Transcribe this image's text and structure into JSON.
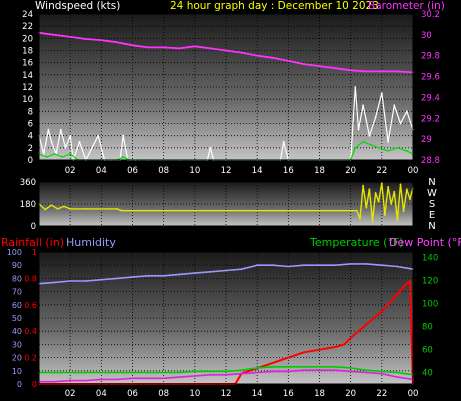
{
  "header": {
    "windspeed_label": "Windspeed (kts)",
    "date_title": "24 hour graph day : December 10 2023",
    "barometer_label": "Barometer (in)"
  },
  "labels": {
    "rainfall": "Rainfall (in)",
    "humidity": "Humidity",
    "temperature": "Temperature (°F)",
    "dewpoint": "Dew Point (°F)"
  },
  "colors": {
    "windspeed": "#ffffff",
    "windgust": "#ffffff",
    "windavg": "#00dd00",
    "barometer": "#ff33ff",
    "direction": "#e6e600",
    "rainfall": "#ff0000",
    "humidity": "#9999ff",
    "temperature": "#00cc00",
    "dewpoint": "#dd22dd",
    "title": "#ffff00",
    "axis": "#ffffff"
  },
  "x_ticks": [
    "02",
    "04",
    "06",
    "08",
    "10",
    "12",
    "14",
    "16",
    "18",
    "20",
    "22",
    "00"
  ],
  "chart_data": [
    {
      "type": "line",
      "name": "wind-barometer",
      "x_range_hours": [
        0,
        24
      ],
      "y_left": {
        "ticks": [
          "0",
          "2",
          "4",
          "6",
          "8",
          "10",
          "12",
          "14",
          "16",
          "18",
          "20",
          "22",
          "24"
        ],
        "ylim": [
          0,
          24
        ]
      },
      "y_right": {
        "ticks": [
          "28.8",
          "29",
          "29.2",
          "29.4",
          "29.6",
          "29.8",
          "30",
          "30.2"
        ],
        "ylim": [
          28.8,
          30.2
        ]
      },
      "series": [
        {
          "key": "barometer",
          "axis": "right",
          "x": [
            0,
            1,
            2,
            3,
            4,
            5,
            6,
            7,
            8,
            9,
            10,
            11,
            12,
            13,
            14,
            15,
            16,
            17,
            18,
            19,
            20,
            21,
            22,
            23,
            24
          ],
          "y": [
            30.02,
            30.0,
            29.98,
            29.96,
            29.95,
            29.93,
            29.9,
            29.88,
            29.88,
            29.87,
            29.89,
            29.87,
            29.85,
            29.83,
            29.8,
            29.78,
            29.75,
            29.72,
            29.7,
            29.68,
            29.66,
            29.65,
            29.65,
            29.65,
            29.64
          ]
        },
        {
          "key": "windgust",
          "axis": "left",
          "x": [
            0,
            0.3,
            0.6,
            0.8,
            1.1,
            1.4,
            1.7,
            2.0,
            2.2,
            2.6,
            3.0,
            3.4,
            3.8,
            4.2,
            4.6,
            5.2,
            5.4,
            5.7,
            6.2,
            7.0,
            9.0,
            10.8,
            11.0,
            11.2,
            12.0,
            14.0,
            15.5,
            15.7,
            16.0,
            18.0,
            20.0,
            20.3,
            20.5,
            20.8,
            21.2,
            21.6,
            22.0,
            22.4,
            22.8,
            23.2,
            23.6,
            24.0
          ],
          "y": [
            4,
            1,
            5,
            3,
            1,
            5,
            2,
            4,
            0,
            3,
            0,
            2,
            4,
            0,
            0,
            0,
            4,
            0,
            0,
            0,
            0,
            0,
            2,
            0,
            0,
            0,
            0,
            3,
            0,
            0,
            0,
            12,
            5,
            9,
            4,
            7,
            11,
            3,
            9,
            6,
            8,
            5
          ]
        },
        {
          "key": "windavg",
          "axis": "left",
          "x": [
            0,
            0.5,
            1.0,
            1.5,
            2.0,
            2.5,
            3.0,
            4.0,
            5.0,
            5.4,
            5.8,
            7.0,
            10.0,
            12.0,
            14.0,
            16.0,
            18.0,
            20.0,
            20.3,
            20.8,
            21.3,
            21.8,
            22.4,
            23.0,
            23.6,
            24.0
          ],
          "y": [
            1,
            0.5,
            1,
            0.5,
            1,
            0,
            0,
            0,
            0,
            0.5,
            0,
            0,
            0,
            0,
            0,
            0,
            0,
            0,
            2,
            3,
            2.5,
            2,
            1.5,
            2,
            1.5,
            1
          ]
        }
      ]
    },
    {
      "type": "line",
      "name": "wind-direction",
      "x_range_hours": [
        0,
        24
      ],
      "y_left": {
        "ticks": [
          "0",
          "180",
          "360"
        ],
        "ylim": [
          0,
          360
        ]
      },
      "y_right_labels": [
        "N",
        "W",
        "S",
        "E",
        "N"
      ],
      "series": [
        {
          "key": "direction",
          "x": [
            0,
            0.4,
            0.8,
            1.2,
            1.6,
            2.0,
            3.0,
            5.0,
            5.3,
            6.0,
            10.0,
            14.0,
            18.0,
            20.0,
            20.4,
            20.6,
            20.8,
            21.0,
            21.2,
            21.4,
            21.6,
            21.8,
            22.0,
            22.2,
            22.4,
            22.6,
            22.8,
            23.0,
            23.2,
            23.4,
            23.6,
            23.8,
            24.0
          ],
          "y": [
            180,
            135,
            170,
            140,
            160,
            140,
            140,
            140,
            125,
            125,
            125,
            125,
            125,
            125,
            125,
            60,
            330,
            150,
            300,
            40,
            270,
            200,
            350,
            90,
            320,
            180,
            280,
            50,
            340,
            120,
            300,
            220,
            310
          ]
        }
      ]
    },
    {
      "type": "line",
      "name": "rain-humidity-temperature",
      "x_range_hours": [
        0,
        24
      ],
      "y_left": {
        "ticks": [
          "0",
          "10",
          "20",
          "30",
          "40",
          "50",
          "60",
          "70",
          "80",
          "90",
          "100"
        ],
        "ylim": [
          0,
          100
        ]
      },
      "y_left2": {
        "ticks": [
          "0",
          "0.2",
          "0.4",
          "0.6",
          "0.8",
          "1"
        ],
        "ylim": [
          0,
          1.0
        ]
      },
      "y_right": {
        "ticks": [
          "40",
          "60",
          "80",
          "100",
          "120",
          "140"
        ],
        "ylim": [
          30,
          145
        ]
      },
      "series": [
        {
          "key": "humidity",
          "axis": "left",
          "x": [
            0,
            1,
            2,
            3,
            4,
            5,
            6,
            7,
            8,
            9,
            10,
            11,
            12,
            13,
            14,
            15,
            16,
            17,
            18,
            19,
            20,
            21,
            22,
            23,
            24
          ],
          "y": [
            76,
            77,
            78,
            78,
            79,
            80,
            81,
            82,
            82,
            83,
            84,
            85,
            86,
            87,
            90,
            90,
            89,
            90,
            90,
            90,
            91,
            91,
            90,
            89,
            87
          ]
        },
        {
          "key": "rainfall",
          "axis": "left2",
          "x": [
            0,
            1,
            2,
            3,
            4,
            5,
            6,
            7,
            8,
            9,
            10,
            11,
            12,
            12.6,
            13.0,
            14.0,
            15.0,
            16.0,
            17.0,
            18.0,
            19.0,
            19.6,
            20.0,
            21.0,
            22.0,
            23.0,
            23.5,
            23.8,
            24.0
          ],
          "y": [
            0,
            0,
            0,
            0,
            0,
            0,
            0,
            0,
            0,
            0,
            0,
            0,
            0,
            0,
            0.08,
            0.12,
            0.16,
            0.2,
            0.24,
            0.26,
            0.28,
            0.3,
            0.35,
            0.45,
            0.55,
            0.68,
            0.75,
            0.78,
            0
          ]
        },
        {
          "key": "temperature",
          "axis": "right",
          "x": [
            0,
            1,
            2,
            3,
            4,
            5,
            6,
            7,
            8,
            9,
            10,
            11,
            12,
            13,
            14,
            15,
            16,
            17,
            18,
            19,
            20,
            21,
            22,
            23,
            24
          ],
          "y": [
            40,
            40,
            40,
            40,
            40,
            40,
            40,
            40,
            40,
            40,
            41,
            41,
            41,
            42,
            44,
            45,
            45,
            45,
            45,
            45,
            44,
            42,
            41,
            40,
            38
          ]
        },
        {
          "key": "dewpoint",
          "axis": "right",
          "x": [
            0,
            1,
            2,
            3,
            4,
            5,
            6,
            7,
            8,
            9,
            10,
            11,
            12,
            13,
            14,
            15,
            16,
            17,
            18,
            19,
            20,
            21,
            22,
            23,
            24
          ],
          "y": [
            32,
            32,
            33,
            33,
            34,
            34,
            35,
            35,
            35,
            36,
            37,
            38,
            38,
            39,
            40,
            41,
            41,
            42,
            42,
            42,
            41,
            40,
            39,
            36,
            34
          ]
        }
      ]
    }
  ]
}
